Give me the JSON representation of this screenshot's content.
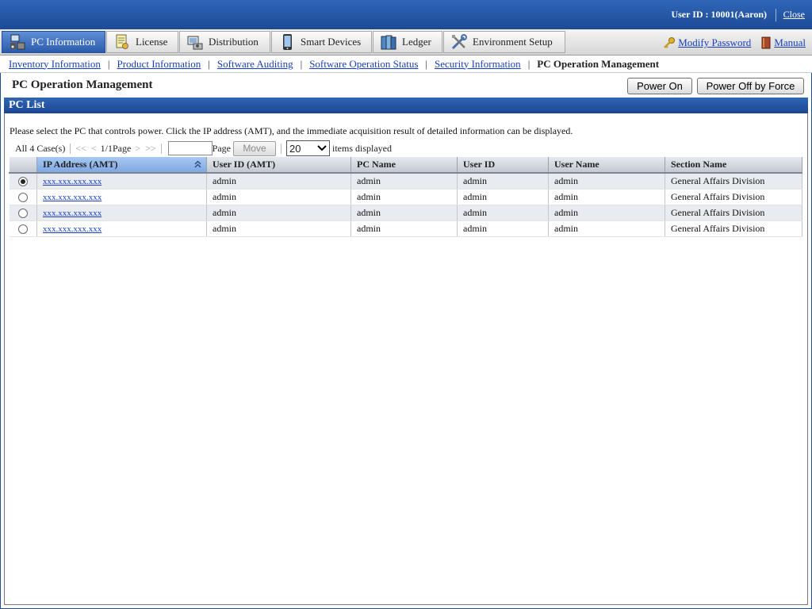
{
  "topbar": {
    "user_label": "User ID : 10001(Aaron)",
    "close_label": "Close"
  },
  "nav": {
    "tabs": [
      {
        "label": "PC Information",
        "icon": "pc-icon"
      },
      {
        "label": "License",
        "icon": "license-icon"
      },
      {
        "label": "Distribution",
        "icon": "distribution-icon"
      },
      {
        "label": "Smart Devices",
        "icon": "smart-device-icon"
      },
      {
        "label": "Ledger",
        "icon": "ledger-icon"
      },
      {
        "label": "Environment Setup",
        "icon": "tools-icon"
      }
    ],
    "modify_password": "Modify Password",
    "manual": "Manual"
  },
  "subnav": {
    "items": [
      "Inventory Information",
      "Product Information",
      "Software Auditing",
      "Software Operation Status",
      "Security Information"
    ],
    "current": "PC Operation Management"
  },
  "page": {
    "title": "PC Operation Management",
    "power_on": "Power On",
    "power_off": "Power Off by Force"
  },
  "panel": {
    "title": "PC List",
    "instruction": "Please select the PC that controls power. Click the IP address (AMT), and the immediate acquisition result of detailed information can be displayed."
  },
  "pager": {
    "total": "All 4 Case(s)",
    "first": "<<",
    "prev": "<",
    "page_info": "1/1Page",
    "next": ">",
    "last": ">>",
    "page_label": "Page",
    "move_label": "Move",
    "per_page": "20",
    "items_label": "items displayed"
  },
  "table": {
    "headers": [
      "IP Address (AMT)",
      "User ID (AMT)",
      "PC Name",
      "User ID",
      "User Name",
      "Section Name"
    ],
    "rows": [
      {
        "ip": "xxx.xxx.xxx.xxx",
        "amt_user": "admin",
        "pc": "admin",
        "uid": "admin",
        "uname": "admin",
        "section": "General Affairs Division"
      },
      {
        "ip": "xxx.xxx.xxx.xxx",
        "amt_user": "admin",
        "pc": "admin",
        "uid": "admin",
        "uname": "admin",
        "section": "General Affairs Division"
      },
      {
        "ip": "xxx.xxx.xxx.xxx",
        "amt_user": "admin",
        "pc": "admin",
        "uid": "admin",
        "uname": "admin",
        "section": "General Affairs Division"
      },
      {
        "ip": "xxx.xxx.xxx.xxx",
        "amt_user": "admin",
        "pc": "admin",
        "uid": "admin",
        "uname": "admin",
        "section": "General Affairs Division"
      }
    ]
  },
  "colors": {
    "header_blue": "#2f66b8",
    "link_blue": "#1a3fbf",
    "sorted_header": "#a8c8f2"
  }
}
